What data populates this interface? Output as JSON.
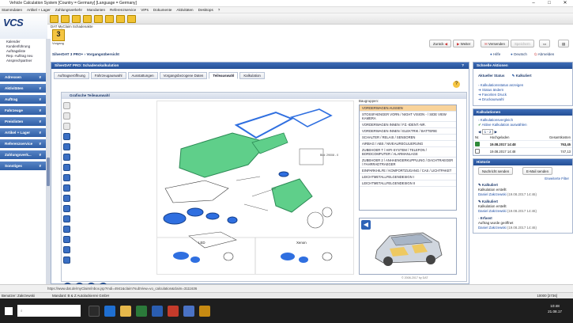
{
  "window": {
    "title": "Vehicle Calculation System [Country = Germany] [Language = Germany]",
    "controls": [
      "–",
      "□",
      "✕"
    ]
  },
  "menu": [
    "Stammdaten",
    "Artikel + Lager",
    "Zahlungsverkehr",
    "Mandanten",
    "Referenzservice",
    "VIPs",
    "Dokumente",
    "Aktivitäten",
    "Desktops",
    "?"
  ],
  "logo_text": "VCS",
  "left_links": [
    "Kalender",
    "Kundenführung",
    "Auftragsliste",
    "Rep.-Auftrag neu",
    "Ansprechpartner"
  ],
  "nav_groups": [
    "Adressen",
    "Aktivitäten",
    "Auftrag",
    "Fahrzeuge",
    "Preislisten",
    "Artikel + Lager",
    "Referenzservice",
    "Zahlungsverk...",
    "Sonstiges"
  ],
  "header": {
    "window_label": "DAT MyClaim Schadenakte",
    "logo_number": "3",
    "logo_sub": "Vorgang",
    "breadcrumb": "SilverDAT 3 PRO+ › Vorgangsübersicht",
    "buttons": [
      "Zurück",
      "Weiter",
      "Versenden",
      "Speichern",
      "Hilfe",
      "Deutsch",
      "Abmelden"
    ]
  },
  "main": {
    "panel_title": "SilverDAT PRO: Schadenskalkulation",
    "tabs": [
      "Auftragseröffnung",
      "Fahrzeugauswahl",
      "Ausstattungen",
      "Vorgangsbezogene Daten",
      "Teileauswahl",
      "Kalkulation"
    ],
    "active_tab": "Teileauswahl",
    "viewer_title": "Grafische Teileauswahl",
    "baugruppen_label": "Baugruppen:",
    "baugruppen": [
      "VORDERWAGEN AUSSEN",
      "STOSSFAENGER VORN / NIGHT VISION - / SIDE VIEW KAMERA",
      "VORDERWAGEN INNEN / FZ.-IDENT.-NR.",
      "VORDERWAGEN INNEN / ELEKTRIK / BATTERIE",
      "SCHALTER / RELAIS / SENSOREN",
      "AIRBAG / ABS / NIVEAUREGULIERUNG",
      "ZUBEHOER T / HIFI-SYSTEM / TELEFON / BORDCOMPUTER / ALARMANLAGE",
      "ZUBEHOER 2 / ANHAENGERKUPPLUNG / DACHTRAEGER / FAHRRADTRAEGER",
      "EINPARKHILFE / KOMFORTZUGANG / CAS / LICHTPAKET",
      "LEICHTMETALLFELGENDESIGN I",
      "LEICHTMETALLFELGENDESIGN II"
    ],
    "drawing_labels": [
      "LED",
      "Xenon",
      "Bild: 29008 - 0"
    ],
    "copyright": "© 2008-2017 by DAT"
  },
  "right": {
    "title": "Schnelle Aktionen",
    "current_status_label": "Aktueller Status",
    "current_status_value": "Kalkuliert",
    "actions": [
      "Kalkulationsstatus anzeigen",
      "Status ändern",
      "Favoriten Druck",
      "Druckauswahl"
    ],
    "kalk_title": "Kalkulationen",
    "kalk_links": [
      "Kalkulationsvergleich",
      "Aktive Kalkulation auswählen"
    ],
    "pager": "1 - 2",
    "table_headers": [
      "Nr.",
      "Hochgeladen",
      "Gesamtkosten"
    ],
    "rows": [
      {
        "date": "19.08.2017 14:48",
        "amount": "763,45"
      },
      {
        "date": "19.08.2017 14:48",
        "amount": "747,13"
      }
    ],
    "history_title": "Historie",
    "history_buttons": [
      "Nachricht senden",
      "E-Mail senden"
    ],
    "history_more": "Erweiterte Filter",
    "history": [
      {
        "status": "Kalkuliert",
        "text": "Kalkulation erstellt",
        "author": "Daniel Zakrzewski",
        "time": "(19.08.2017 14:46)"
      },
      {
        "status": "Kalkuliert",
        "text": "Kalkulation erstellt",
        "author": "Daniel Zakrzewski",
        "time": "(19.08.2017 14:46)"
      },
      {
        "status": "Erfasst",
        "text": "Auftrag wurde geöffnet",
        "author": "Daniel Zakrzewski",
        "time": "(19.08.2017 14:46)"
      }
    ]
  },
  "status": {
    "url": "https://www.dat.de/myClaim/inbox.jsp?mdi=4941&claim?subView=vo_calculation&claim=3111636",
    "user": "Benutzer: Zakrzewski",
    "mandant": "Mandant: B & Z Autolackierrei GmbH",
    "right_code": "10000 [2736]"
  },
  "taskbar": {
    "time": "10:48",
    "date": "21.08.17"
  },
  "colors": {
    "nav_blue": "#2f5ea6",
    "highlight_orange": "#f9d39a",
    "part_green": "#5fcf8a",
    "part_blue": "#2f6fe0"
  }
}
